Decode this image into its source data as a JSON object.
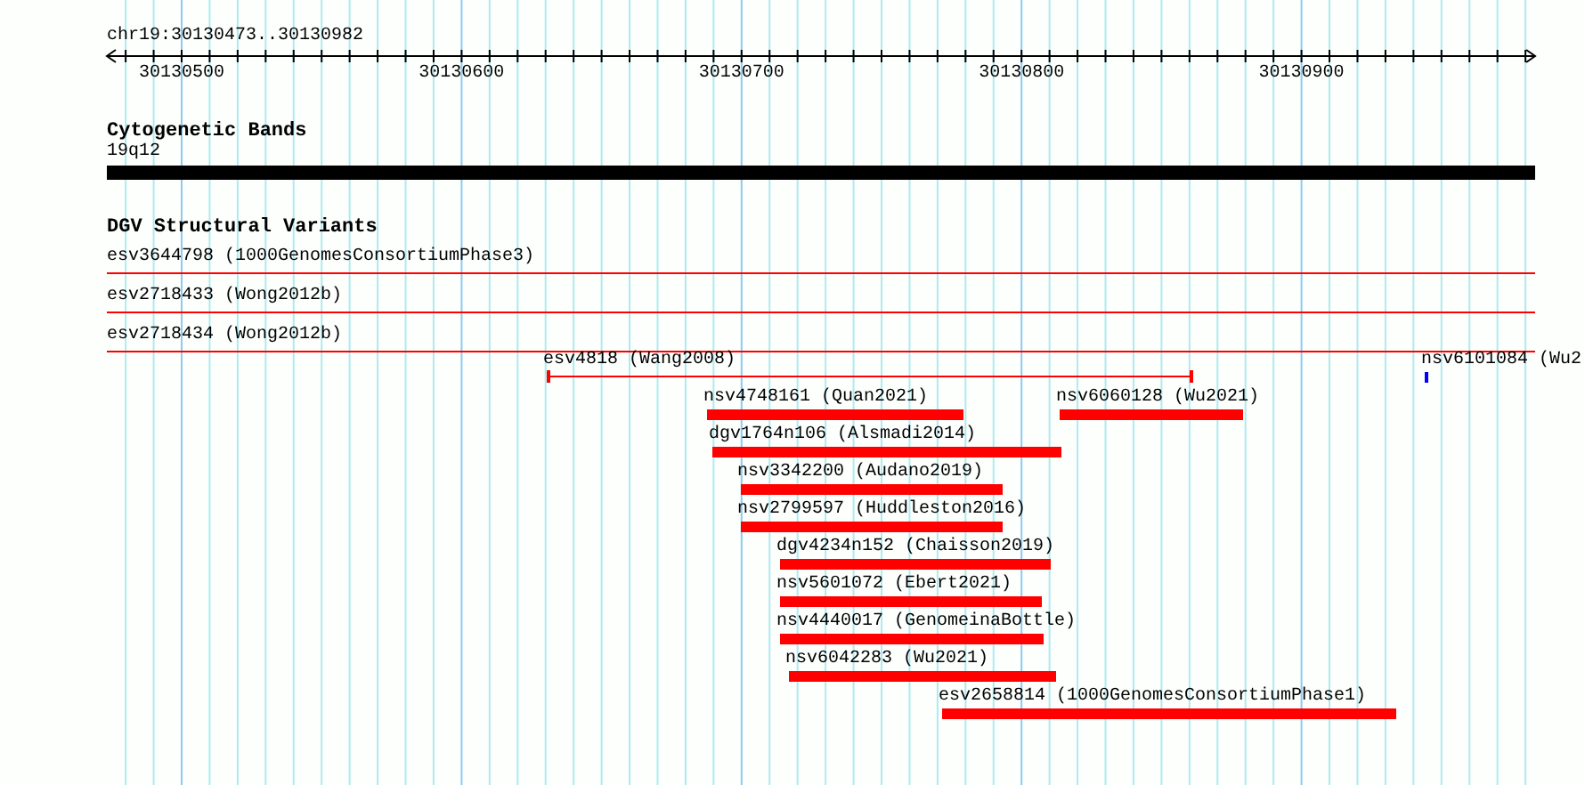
{
  "location": "chr19:30130473..30130982",
  "ruler": {
    "ticks": [
      "30130500",
      "30130600",
      "30130700",
      "30130800",
      "30130900"
    ]
  },
  "cytoband_track": {
    "title": "Cytogenetic Bands",
    "band": {
      "label": "19q12"
    }
  },
  "variant_track": {
    "title": "DGV Structural Variants",
    "collapsed_rows": [
      {
        "label": "esv3644798 (1000GenomesConsortiumPhase3)"
      },
      {
        "label": "esv2718433 (Wong2012b)"
      },
      {
        "label": "esv2718434 (Wong2012b)"
      }
    ],
    "features": [
      {
        "label": "esv4818 (Wang2008)",
        "kind": "span",
        "color": "#ff0000"
      },
      {
        "label": "nsv6101084 (Wu2",
        "kind": "bar",
        "color": "#0000ff"
      },
      {
        "label": "nsv4748161 (Quan2021)",
        "kind": "bar",
        "color": "#ff0000"
      },
      {
        "label": "nsv6060128 (Wu2021)",
        "kind": "bar",
        "color": "#ff0000"
      },
      {
        "label": "dgv1764n106 (Alsmadi2014)",
        "kind": "bar",
        "color": "#ff0000"
      },
      {
        "label": "nsv3342200 (Audano2019)",
        "kind": "bar",
        "color": "#ff0000"
      },
      {
        "label": "nsv2799597 (Huddleston2016)",
        "kind": "bar",
        "color": "#ff0000"
      },
      {
        "label": "dgv4234n152 (Chaisson2019)",
        "kind": "bar",
        "color": "#ff0000"
      },
      {
        "label": "nsv5601072 (Ebert2021)",
        "kind": "bar",
        "color": "#ff0000"
      },
      {
        "label": "nsv4440017 (GenomeinaBottle)",
        "kind": "bar",
        "color": "#ff0000"
      },
      {
        "label": "nsv6042283 (Wu2021)",
        "kind": "bar",
        "color": "#ff0000"
      },
      {
        "label": "esv2658814 (1000GenomesConsortiumPhase1)",
        "kind": "bar",
        "color": "#ff0000"
      }
    ]
  }
}
